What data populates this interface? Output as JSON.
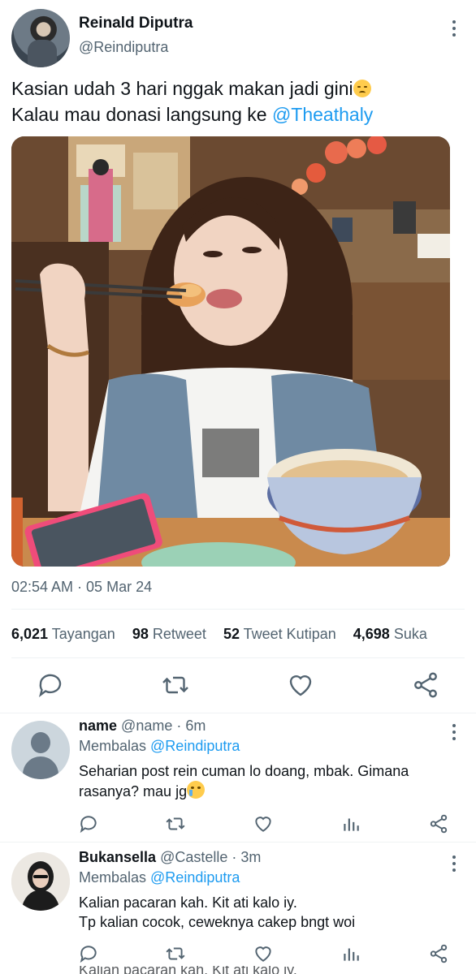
{
  "colors": {
    "accent": "#1d9bf0",
    "text": "#0f1419",
    "muted": "#536471",
    "divider": "#eff3f4"
  },
  "tweet": {
    "author_name": "Reinald Diputra",
    "author_handle": "@Reindiputra",
    "text_line1": "Kasian udah 3 hari nggak makan jadi gini",
    "text_line1_emoji": "pensive-face-emoji",
    "text_line2_prefix": "Kalau mau donasi langsung ke ",
    "text_line2_mention": "@Theathaly",
    "media": "photo-woman-eating-in-restaurant",
    "timestamp": "02:54 AM · 05 Mar 24",
    "stats": {
      "views_count": "6,021",
      "views_label": "Tayangan",
      "retweets_count": "98",
      "retweets_label": "Retweet",
      "quotes_count": "52",
      "quotes_label": "Tweet Kutipan",
      "likes_count": "4,698",
      "likes_label": "Suka"
    },
    "actions": [
      "reply-icon",
      "retweet-icon",
      "like-icon",
      "share-icon"
    ]
  },
  "replies": [
    {
      "name": "name",
      "handle": "@name",
      "time": "· 6m",
      "replying_prefix": "Membalas ",
      "replying_to": "@Reindiputra",
      "text_line1": "Seharian post rein cuman lo doang, mbak. Gimana",
      "text_line2": "rasanya? mau jg",
      "emoji": "crying-face-emoji",
      "avatar": "default-avatar"
    },
    {
      "name": "Bukansella",
      "handle": "@Castelle",
      "time": "· 3m",
      "replying_prefix": "Membalas ",
      "replying_to": "@Reindiputra",
      "text_line1": "Kalian pacaran kah. Kit ati kalo iy.",
      "text_line2": "Tp kalian cocok, ceweknya cakep bngt woi",
      "avatar": "photo-avatar"
    }
  ],
  "reply_actions": [
    "reply-icon",
    "retweet-icon",
    "like-icon",
    "analytics-icon",
    "share-icon"
  ],
  "cut_off_text": "Kalian pacaran kah. Kit ati kalo iy."
}
